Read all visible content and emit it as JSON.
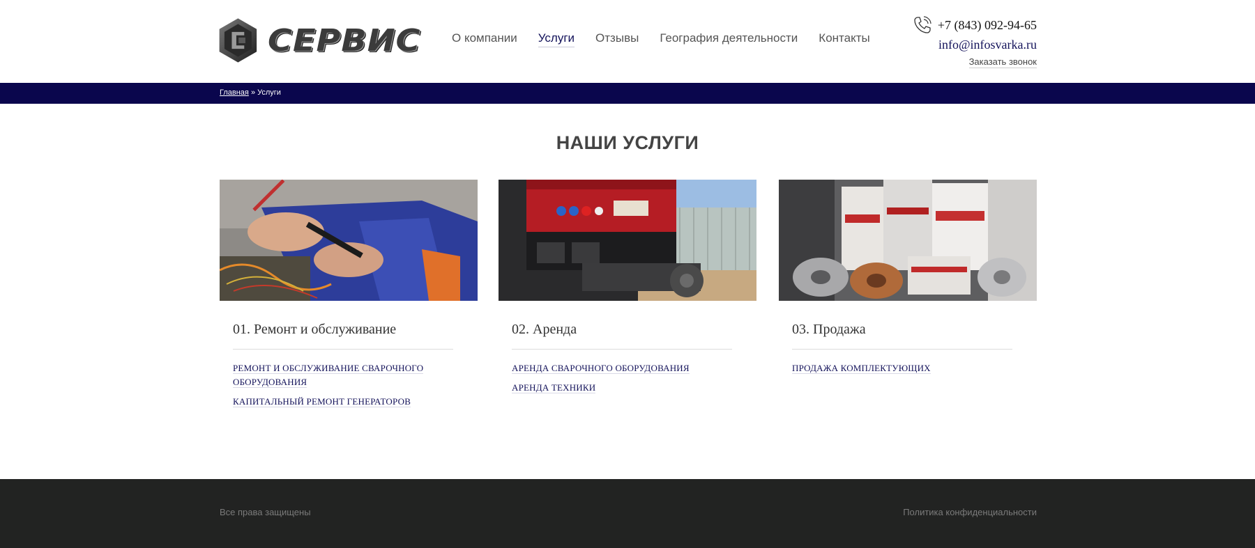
{
  "header": {
    "logo_text": "СЕРВИС",
    "nav": [
      {
        "label": "О компании",
        "active": false
      },
      {
        "label": "Услуги",
        "active": true
      },
      {
        "label": "Отзывы",
        "active": false
      },
      {
        "label": "География деятельности",
        "active": false
      },
      {
        "label": "Контакты",
        "active": false
      }
    ],
    "phone": "+7 (843) 092-94-65",
    "email": "info@infosvarka.ru",
    "callback": "Заказать звонок"
  },
  "breadcrumb": {
    "home": "Главная",
    "separator": "»",
    "current": "Услуги"
  },
  "main": {
    "title": "НАШИ УСЛУГИ",
    "cards": [
      {
        "title": "01. Ремонт и обслуживание",
        "image": "repair-photo",
        "links": [
          "Ремонт и обслуживание сварочного оборудования",
          "Капитальный ремонт генераторов"
        ]
      },
      {
        "title": "02. Аренда",
        "image": "generator-rental-photo",
        "links": [
          "Аренда сварочного оборудования",
          "Аренда техники"
        ]
      },
      {
        "title": "03. Продажа",
        "image": "welding-supplies-photo",
        "links": [
          "Продажа комплектующих"
        ]
      }
    ]
  },
  "footer": {
    "rights": "Все права защищены",
    "policy": "Политика конфиденциальности"
  },
  "colors": {
    "accent": "#0a064d",
    "link": "#13125a",
    "footer_bg": "#222322"
  }
}
